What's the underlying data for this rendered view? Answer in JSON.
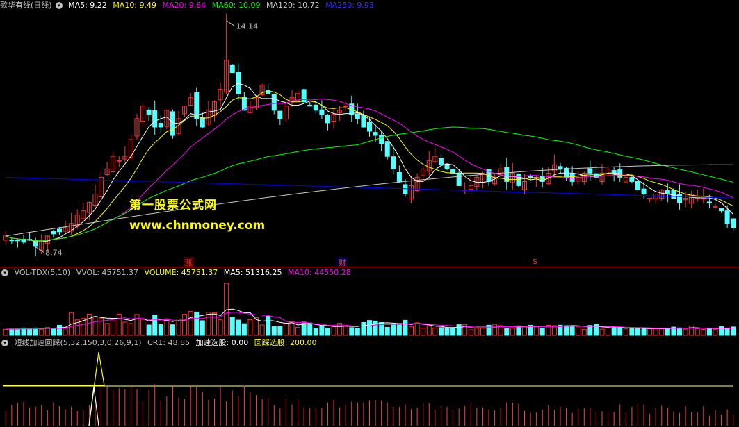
{
  "colors": {
    "up": "#ff3232",
    "down": "#54ffff",
    "ma5": "#ffffff",
    "ma10": "#ffff00",
    "ma20": "#ff00ff",
    "ma60": "#00ff00",
    "ma120": "#c8c8c8",
    "ma250": "#0000ff",
    "vol_label": "#ffff00",
    "cr": "#ff4040"
  },
  "main": {
    "stock_name": "歌华有线(日线)",
    "icon": "settings-circle-icon",
    "ma_labels": [
      "MA5: 9.22",
      "MA10: 9.49",
      "MA20: 9.64",
      "MA60: 10.09",
      "MA120: 10.72",
      "MA250: 9.93"
    ],
    "high_label": "14.14",
    "low_label": "8.74",
    "watermark_cn": "第一股票公式网",
    "watermark_url": "www.chnmoney.com",
    "event_tags": [
      "涨",
      "财",
      "$"
    ]
  },
  "vol": {
    "labels": [
      "VOL-TDX(5,10)",
      "VVOL: 45751.37",
      "VOLUME: 45751.37",
      "MA5: 51316.25",
      "MA10: 44550.28"
    ]
  },
  "indicator": {
    "labels": [
      "短线加速回踩(5,32,150,3,0,26,9,1)",
      "CR1: 48.85",
      "加速选股: 0.00",
      "回踩选股: 200.00"
    ]
  },
  "chart_data": {
    "type": "candlestick",
    "price_range": [
      8.74,
      14.14
    ],
    "closes": [
      9.0,
      8.9,
      8.9,
      8.85,
      8.9,
      8.75,
      8.9,
      9.0,
      9.05,
      9.1,
      9.2,
      9.3,
      9.5,
      9.6,
      9.8,
      10.0,
      10.4,
      10.6,
      10.9,
      10.8,
      10.9,
      11.3,
      11.8,
      12.1,
      11.9,
      11.6,
      11.6,
      12.0,
      11.4,
      11.8,
      12.1,
      12.3,
      11.8,
      11.6,
      12.0,
      12.2,
      12.5,
      13.2,
      12.9,
      12.4,
      12.0,
      12.1,
      12.3,
      12.6,
      12.4,
      12.0,
      11.8,
      12.1,
      12.3,
      12.4,
      12.2,
      12.1,
      12.0,
      11.9,
      11.7,
      11.9,
      12.0,
      12.1,
      11.9,
      11.8,
      11.6,
      11.5,
      11.4,
      11.2,
      10.9,
      10.6,
      10.3,
      10.0,
      10.2,
      10.4,
      10.6,
      10.8,
      10.9,
      10.7,
      10.6,
      10.5,
      10.2,
      10.1,
      10.2,
      10.4,
      10.5,
      10.3,
      10.4,
      10.6,
      10.3,
      10.5,
      10.2,
      10.3,
      10.4,
      10.4,
      10.3,
      10.5,
      10.7,
      10.6,
      10.4,
      10.3,
      10.4,
      10.5,
      10.5,
      10.4,
      10.5,
      10.6,
      10.5,
      10.4,
      10.4,
      10.3,
      10.1,
      10.0,
      9.9,
      10.0,
      10.1,
      10.0,
      9.9,
      9.8,
      9.9,
      10.0,
      9.95,
      9.9,
      9.8,
      9.7,
      9.6,
      9.3,
      9.2
    ]
  }
}
